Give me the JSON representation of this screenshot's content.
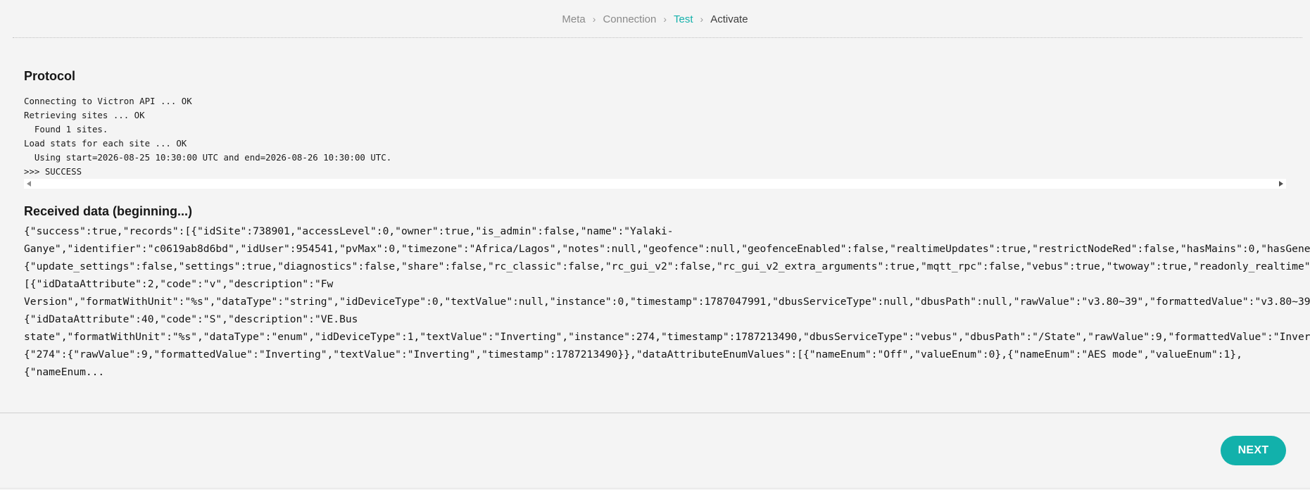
{
  "stepper": {
    "steps": [
      {
        "label": "Meta",
        "state": "done"
      },
      {
        "label": "Connection",
        "state": "done"
      },
      {
        "label": "Test",
        "state": "current"
      },
      {
        "label": "Activate",
        "state": "upcoming"
      }
    ],
    "separator": "›"
  },
  "protocol": {
    "title": "Protocol",
    "lines": [
      "Connecting to Victron API ... OK",
      "Retrieving sites ... OK",
      "  Found 1 sites.",
      "Load stats for each site ... OK",
      "  Using start=2026-08-25 10:30:00 UTC and end=2026-08-26 10:30:00 UTC.",
      ">>> SUCCESS"
    ]
  },
  "received": {
    "title": "Received data (beginning...)",
    "lines": [
      "{\"success\":true,\"records\":[{\"idSite\":738901,\"accessLevel\":0,\"owner\":true,\"is_admin\":false,\"name\":\"Yalaki-",
      "Ganye\",\"identifier\":\"c0619ab8d6bd\",\"idUser\":954541,\"pvMax\":0,\"timezone\":\"Africa/Lagos\",\"notes\":null,\"geofence\":null,\"geofenceEnabled\":false,\"realtimeUpdates\":true,\"restrictNodeRed\":false,\"hasMains\":0,\"hasGene",
      "{\"update_settings\":false,\"settings\":true,\"diagnostics\":false,\"share\":false,\"rc_classic\":false,\"rc_gui_v2\":false,\"rc_gui_v2_extra_arguments\":true,\"mqtt_rpc\":false,\"vebus\":true,\"twoway\":true,\"readonly_realtime\"",
      "[{\"idDataAttribute\":2,\"code\":\"v\",\"description\":\"Fw",
      "Version\",\"formatWithUnit\":\"%s\",\"dataType\":\"string\",\"idDeviceType\":0,\"textValue\":null,\"instance\":0,\"timestamp\":1787047991,\"dbusServiceType\":null,\"dbusPath\":null,\"rawValue\":\"v3.80~39\",\"formattedValue\":\"v3.80~39",
      "{\"idDataAttribute\":40,\"code\":\"S\",\"description\":\"VE.Bus",
      "state\",\"formatWithUnit\":\"%s\",\"dataType\":\"enum\",\"idDeviceType\":1,\"textValue\":\"Inverting\",\"instance\":274,\"timestamp\":1787213490,\"dbusServiceType\":\"vebus\",\"dbusPath\":\"/State\",\"rawValue\":9,\"formattedValue\":\"Inver",
      "{\"274\":{\"rawValue\":9,\"formattedValue\":\"Inverting\",\"textValue\":\"Inverting\",\"timestamp\":1787213490}},\"dataAttributeEnumValues\":[{\"nameEnum\":\"Off\",\"valueEnum\":0},{\"nameEnum\":\"AES mode\",\"valueEnum\":1},",
      "{\"nameEnum..."
    ]
  },
  "actions": {
    "next_label": "NEXT"
  },
  "colors": {
    "accent": "#12b1ab",
    "background": "#f4f4f4"
  }
}
